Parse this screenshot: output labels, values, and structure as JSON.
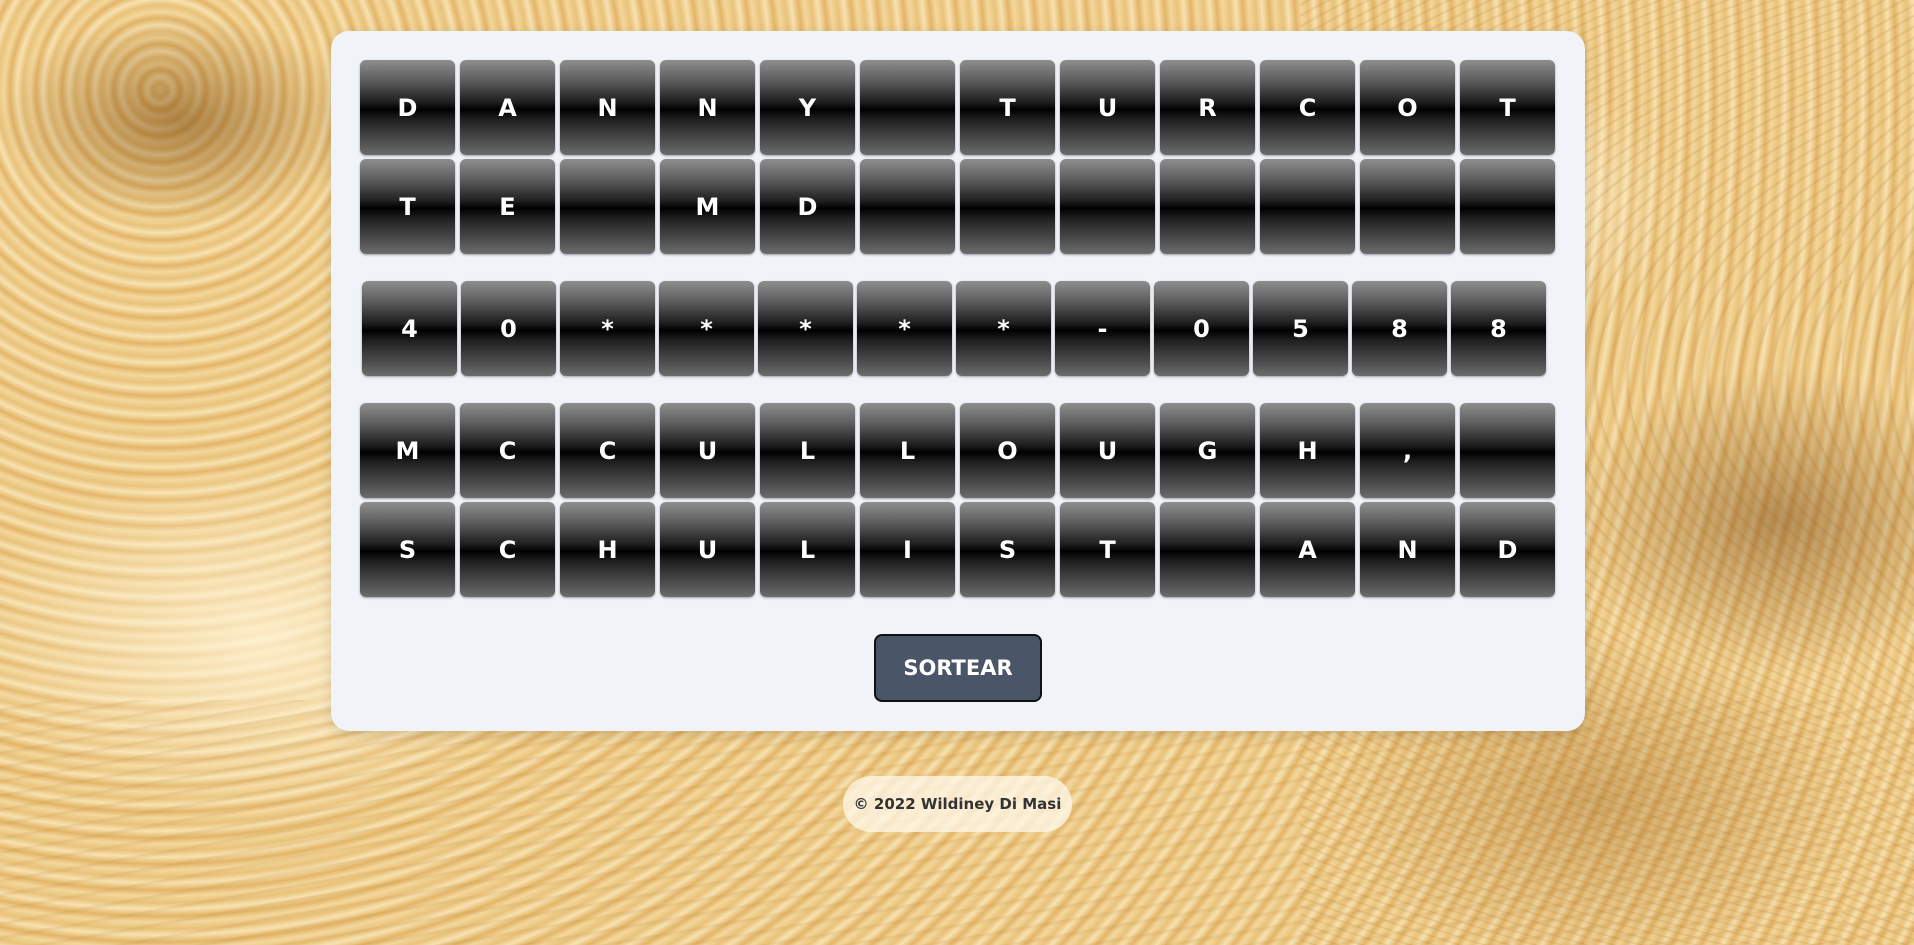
{
  "board": {
    "rows": [
      [
        "D",
        "A",
        "N",
        "N",
        "Y",
        "",
        "T",
        "U",
        "R",
        "C",
        "O",
        "T"
      ],
      [
        "T",
        "E",
        "",
        "M",
        "D",
        "",
        "",
        "",
        "",
        "",
        "",
        ""
      ],
      [
        "4",
        "0",
        "*",
        "*",
        "*",
        "*",
        "*",
        "-",
        "0",
        "5",
        "8",
        "8"
      ],
      [
        "M",
        "C",
        "C",
        "U",
        "L",
        "L",
        "O",
        "U",
        "G",
        "H",
        ",",
        ""
      ],
      [
        "S",
        "C",
        "H",
        "U",
        "L",
        "I",
        "S",
        "T",
        "",
        "A",
        "N",
        "D"
      ]
    ]
  },
  "actions": {
    "draw_label": "SORTEAR"
  },
  "footer": {
    "copyright": "© 2022 Wildiney Di Masi"
  }
}
